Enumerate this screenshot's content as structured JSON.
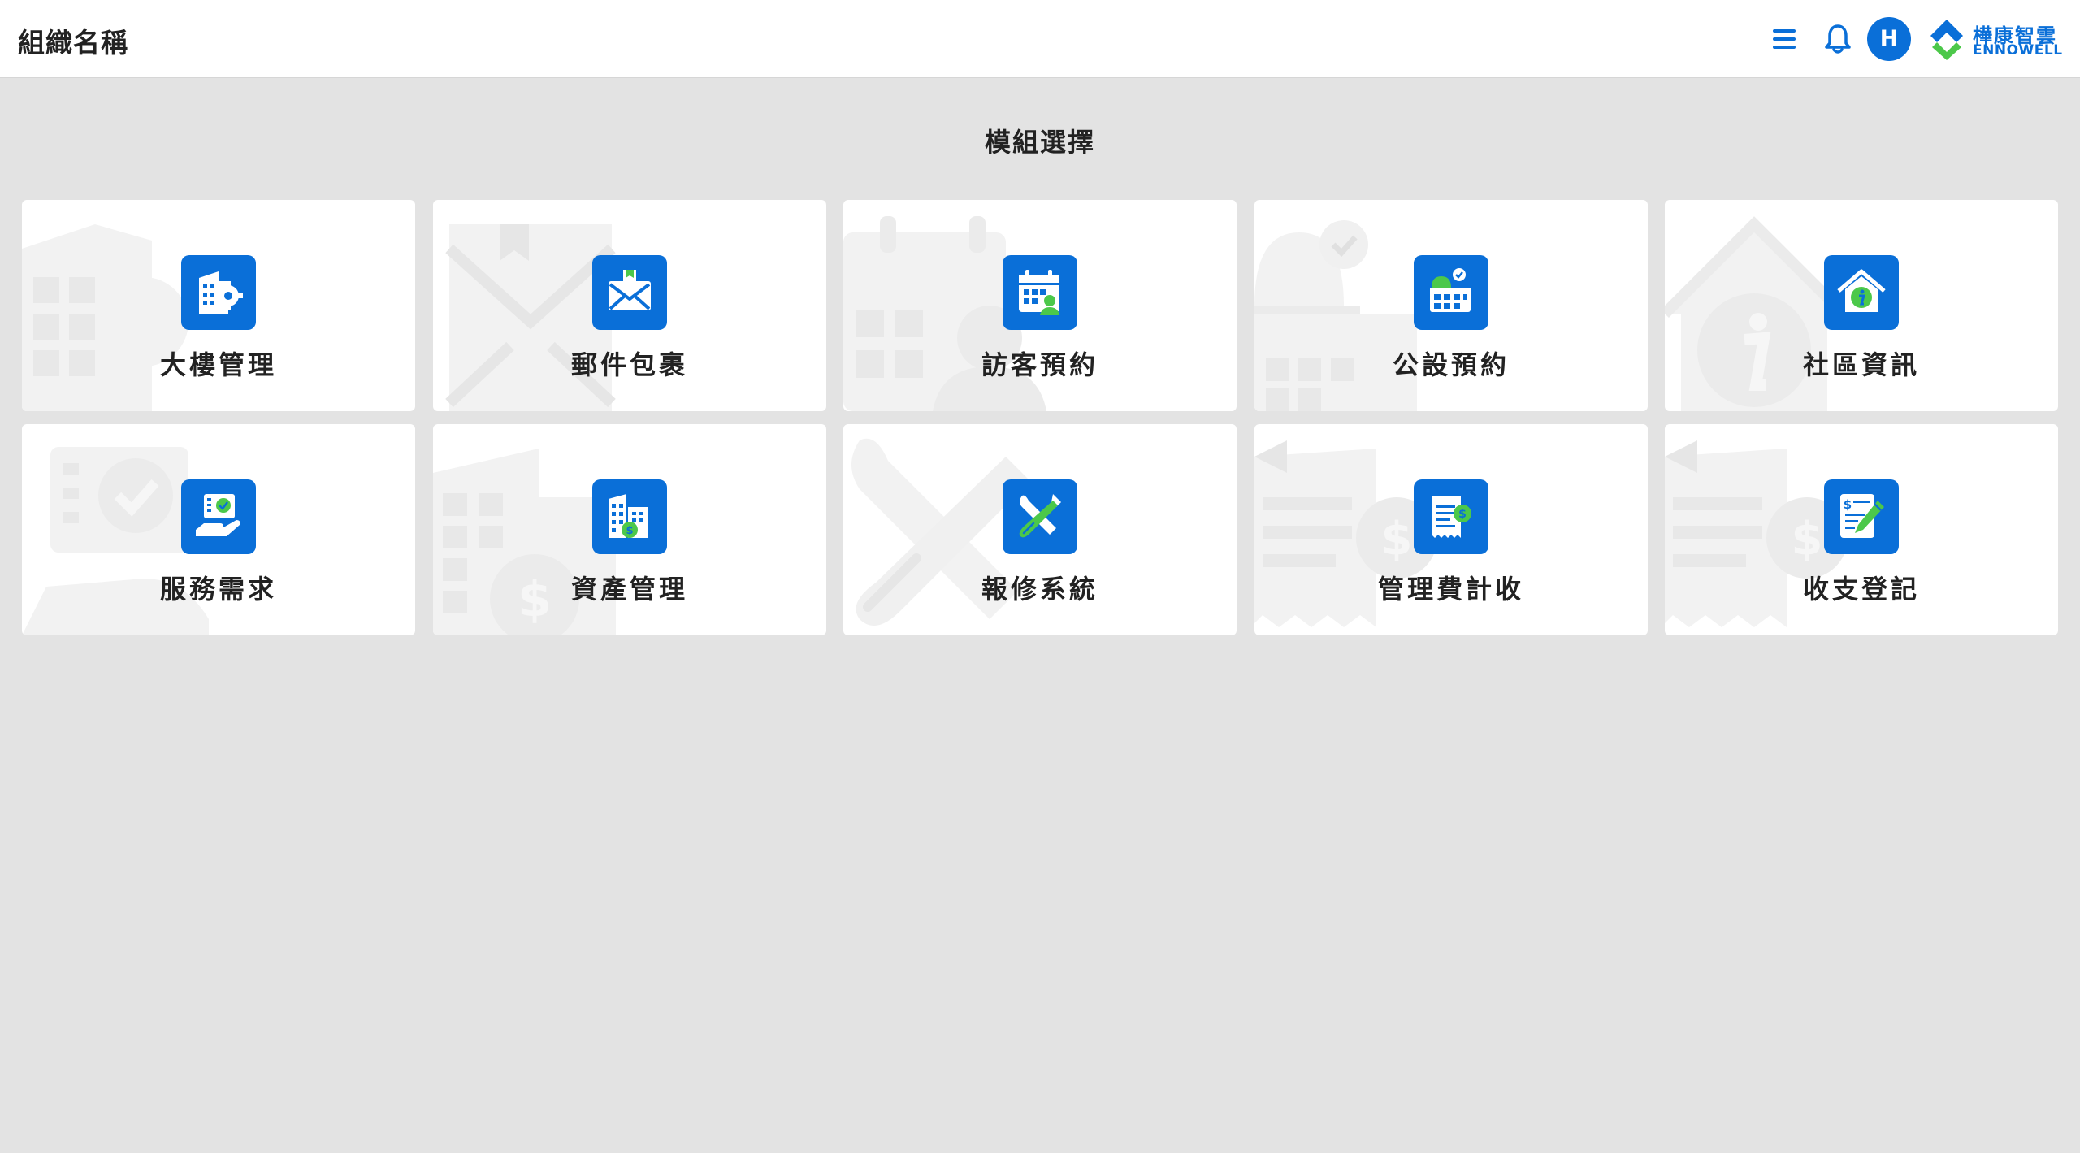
{
  "header": {
    "org_name": "組織名稱",
    "avatar_initial": "H",
    "logo_cn": "樺康智雲",
    "logo_en": "ENNOWELL"
  },
  "main": {
    "title": "模組選擇",
    "modules": [
      {
        "label": "大樓管理",
        "icon": "building-gear-icon"
      },
      {
        "label": "郵件包裹",
        "icon": "mail-envelope-icon"
      },
      {
        "label": "訪客預約",
        "icon": "calendar-visitor-icon"
      },
      {
        "label": "公設預約",
        "icon": "facility-calendar-icon"
      },
      {
        "label": "社區資訊",
        "icon": "house-info-icon"
      },
      {
        "label": "服務需求",
        "icon": "service-hand-icon"
      },
      {
        "label": "資產管理",
        "icon": "asset-building-icon"
      },
      {
        "label": "報修系統",
        "icon": "repair-tools-icon"
      },
      {
        "label": "管理費計收",
        "icon": "fee-receipt-icon"
      },
      {
        "label": "收支登記",
        "icon": "ledger-pen-icon"
      }
    ]
  },
  "colors": {
    "accent": "#0a6fd8",
    "accent_green": "#4cc84a",
    "page_bg": "#e3e3e3",
    "card_bg": "#ffffff"
  }
}
